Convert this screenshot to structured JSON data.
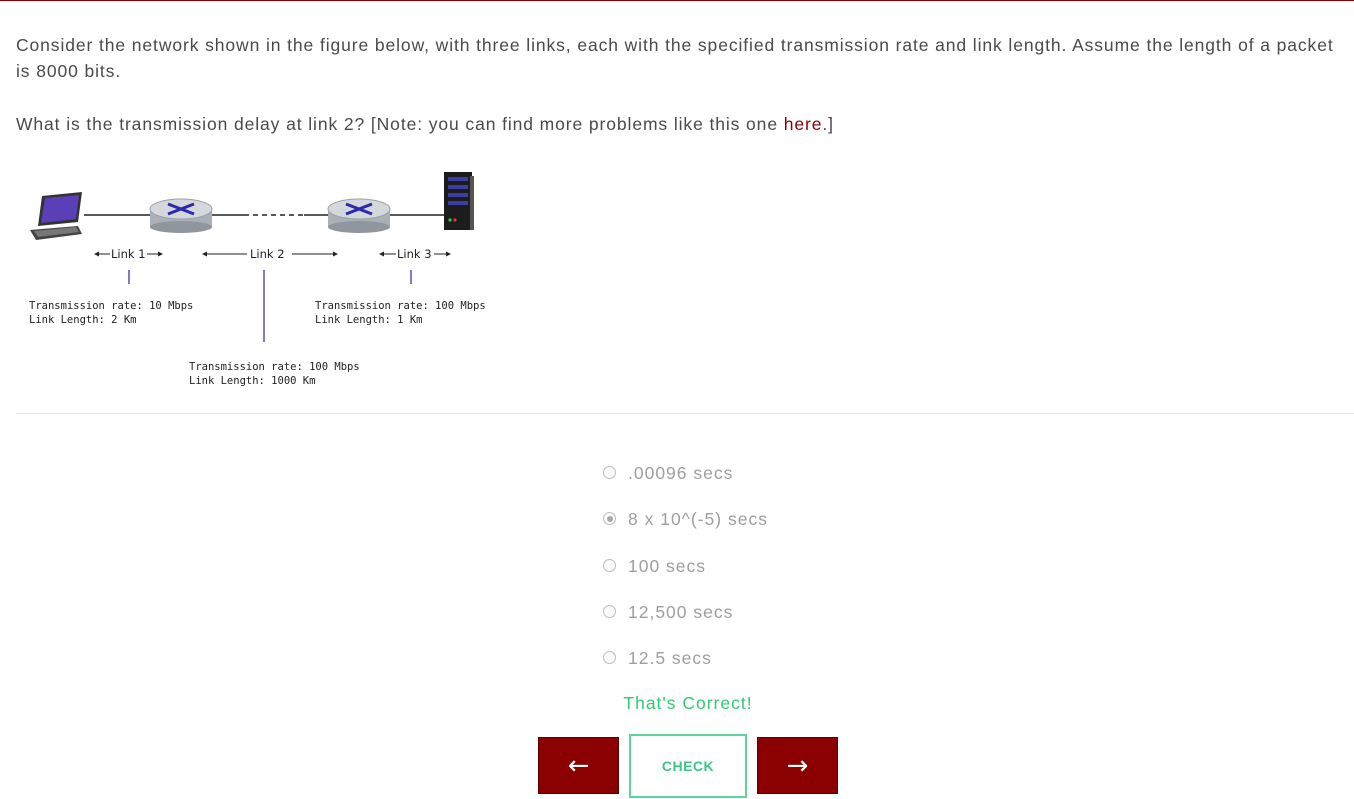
{
  "question": {
    "paragraph1": "Consider the network shown in the figure below, with three links, each with the specified transmission rate and link length. Assume the length of a packet is 8000 bits.",
    "paragraph2_prefix": "What is the transmission delay at link 2?  [Note: you can find more problems like this one ",
    "link_text": "here",
    "paragraph2_suffix": ".]"
  },
  "figure": {
    "link1_label": "Link 1",
    "link2_label": "Link 2",
    "link3_label": "Link 3",
    "link1_rate": "Transmission rate: 10 Mbps",
    "link1_length": "Link Length: 2 Km",
    "link2_rate": "Transmission rate: 100 Mbps",
    "link2_length": "Link Length: 1000 Km",
    "link3_rate": "Transmission rate: 100 Mbps",
    "link3_length": "Link Length: 1 Km"
  },
  "choices": [
    {
      "label": ".00096 secs",
      "selected": false
    },
    {
      "label": "8 x 10^(-5) secs",
      "selected": true
    },
    {
      "label": "100 secs",
      "selected": false
    },
    {
      "label": "12,500 secs",
      "selected": false
    },
    {
      "label": "12.5 secs",
      "selected": false
    }
  ],
  "feedback": "That's Correct!",
  "buttons": {
    "prev": "←",
    "check": "CHECK",
    "next": "→"
  },
  "colors": {
    "accent": "#8b0000",
    "success": "#2ecc71"
  }
}
